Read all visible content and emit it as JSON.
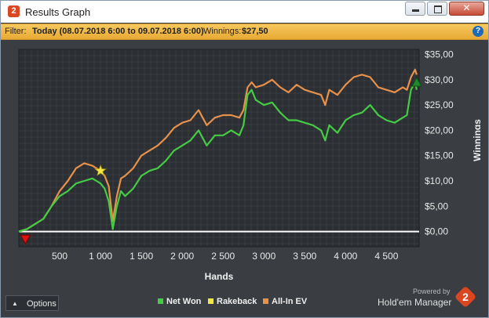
{
  "window": {
    "title": "Results Graph",
    "app_icon_text": "2"
  },
  "filter": {
    "label": "Filter:",
    "value": "Today (08.07.2018 6:00 to 09.07.2018 6:00)",
    "winnings_label": "Winnings:",
    "winnings_value": "$27,50",
    "help_text": "?"
  },
  "chart_data": {
    "type": "line",
    "xlabel": "Hands",
    "ylabel": "Winnings",
    "xlim": [
      0,
      4900
    ],
    "ylim": [
      -3,
      36
    ],
    "xticks": [
      500,
      1000,
      1500,
      2000,
      2500,
      3000,
      3500,
      4000,
      4500
    ],
    "xtick_labels": [
      "500",
      "1 000",
      "1 500",
      "2 000",
      "2 500",
      "3 000",
      "3 500",
      "4 000",
      "4 500"
    ],
    "yticks": [
      0,
      5,
      10,
      15,
      20,
      25,
      30,
      35
    ],
    "ytick_labels": [
      "$0,00",
      "$5,00",
      "$10,00",
      "$15,00",
      "$20,00",
      "$25,00",
      "$30,00",
      "$35,00"
    ],
    "grid": true,
    "legend_position": "bottom",
    "series": [
      {
        "name": "Net Won",
        "color": "#44cc44",
        "x": [
          0,
          100,
          200,
          300,
          400,
          500,
          600,
          700,
          800,
          900,
          950,
          1000,
          1050,
          1100,
          1150,
          1200,
          1250,
          1300,
          1400,
          1500,
          1600,
          1700,
          1800,
          1900,
          2000,
          2100,
          2200,
          2300,
          2400,
          2500,
          2600,
          2700,
          2750,
          2800,
          2850,
          2900,
          3000,
          3100,
          3200,
          3300,
          3400,
          3500,
          3600,
          3700,
          3750,
          3800,
          3900,
          4000,
          4100,
          4200,
          4300,
          4400,
          4500,
          4600,
          4700,
          4750,
          4800,
          4850,
          4870
        ],
        "values": [
          0,
          0.5,
          1.5,
          2.5,
          5,
          7,
          8,
          9.5,
          10,
          10.5,
          10,
          9.5,
          8.5,
          6,
          0.5,
          5,
          8,
          7,
          8.5,
          11,
          12,
          12.5,
          14,
          16,
          17,
          18,
          20,
          17,
          19,
          19,
          20,
          19,
          21,
          27,
          28,
          26,
          25,
          25.5,
          23.5,
          22,
          22,
          21.5,
          21,
          20,
          18,
          21,
          19.5,
          22,
          23,
          23.5,
          25,
          23,
          22,
          21.5,
          22.5,
          23,
          28,
          29.5,
          28
        ]
      },
      {
        "name": "Rakeback",
        "color": "#f5e642",
        "x": [
          1000
        ],
        "values": [
          12
        ]
      },
      {
        "name": "All-In EV",
        "color": "#e8914a",
        "x": [
          0,
          100,
          200,
          300,
          400,
          500,
          600,
          700,
          800,
          900,
          950,
          1000,
          1050,
          1100,
          1150,
          1200,
          1250,
          1300,
          1400,
          1500,
          1600,
          1700,
          1800,
          1900,
          2000,
          2100,
          2200,
          2300,
          2400,
          2500,
          2600,
          2700,
          2750,
          2800,
          2850,
          2900,
          3000,
          3100,
          3200,
          3300,
          3400,
          3500,
          3600,
          3700,
          3750,
          3800,
          3900,
          4000,
          4100,
          4200,
          4300,
          4400,
          4500,
          4600,
          4700,
          4750,
          4800,
          4850,
          4870
        ],
        "values": [
          0,
          0.5,
          1.5,
          2.5,
          5,
          8,
          10,
          12.5,
          13.5,
          13,
          12.5,
          12,
          11,
          9,
          2,
          7,
          10.5,
          11,
          12.5,
          15,
          16,
          17,
          18.5,
          20.5,
          21.5,
          22,
          24,
          21,
          22.5,
          23,
          23,
          22.5,
          24,
          28.5,
          29.5,
          28.5,
          29,
          30,
          28.5,
          27.5,
          29,
          28,
          27.5,
          27,
          25,
          28,
          27,
          29,
          30.5,
          31,
          30.5,
          28.5,
          28,
          27.5,
          28.5,
          28,
          30.5,
          32,
          31
        ]
      }
    ],
    "markers": [
      {
        "shape": "triangle-down",
        "color": "#dd1111",
        "x": 80,
        "y": -1.5
      },
      {
        "shape": "star",
        "color": "#f5e642",
        "x": 1000,
        "y": 12
      },
      {
        "shape": "triangle-up",
        "color": "#1f8a2a",
        "x": 4870,
        "y": 29.5
      }
    ]
  },
  "bottom": {
    "options_label": "Options",
    "powered_by": "Powered by",
    "brand": "Hold'em Manager",
    "brand_logo_text": "2"
  }
}
